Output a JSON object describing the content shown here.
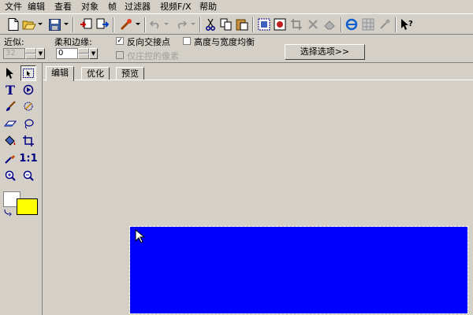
{
  "menu": [
    "文件",
    "编辑",
    "查看",
    "对象",
    "帧",
    "过滤器",
    "视频F/X",
    "帮助"
  ],
  "toolbar": {
    "icons": [
      "new-file-icon",
      "open-folder-icon",
      "save-icon",
      "import-icon",
      "export-icon",
      "effect-wand-icon",
      "undo-icon",
      "redo-icon",
      "cut-icon",
      "copy-icon",
      "paste-icon",
      "select-all-icon",
      "select-object-icon",
      "crop-icon",
      "delete-icon",
      "erase-icon",
      "browser-preview-icon",
      "grid-icon",
      "help-pointer-icon"
    ]
  },
  "options": {
    "tolerance_label": "近似:",
    "tolerance_value": "32",
    "feather_label": "柔和边缘:",
    "feather_value": "0",
    "invert_label": "反向交接点",
    "invert_checked": true,
    "aspect_label": "高度与宽度均衡",
    "aspect_checked": false,
    "only_selected_label": "仅庄控的像素",
    "only_selected_checked": false,
    "select_options_button": "选择选项>>"
  },
  "tools": [
    "arrow-pointer-icon",
    "object-select-icon",
    "text-tool-icon",
    "motion-path-icon",
    "paintbrush-icon",
    "magic-select-icon",
    "eraser-icon",
    "lasso-icon",
    "paint-bucket-icon",
    "crop-tool-icon",
    "eyedropper-icon",
    "actual-size-icon",
    "zoom-in-icon",
    "zoom-out-icon"
  ],
  "tools_text": {
    "text_tool": "T",
    "actual_size": "1:1"
  },
  "colors": {
    "foreground": "#ffffff",
    "background": "#ffff00",
    "canvas_object": "#0000ff"
  },
  "tabs": [
    "编辑",
    "优化",
    "预览"
  ]
}
